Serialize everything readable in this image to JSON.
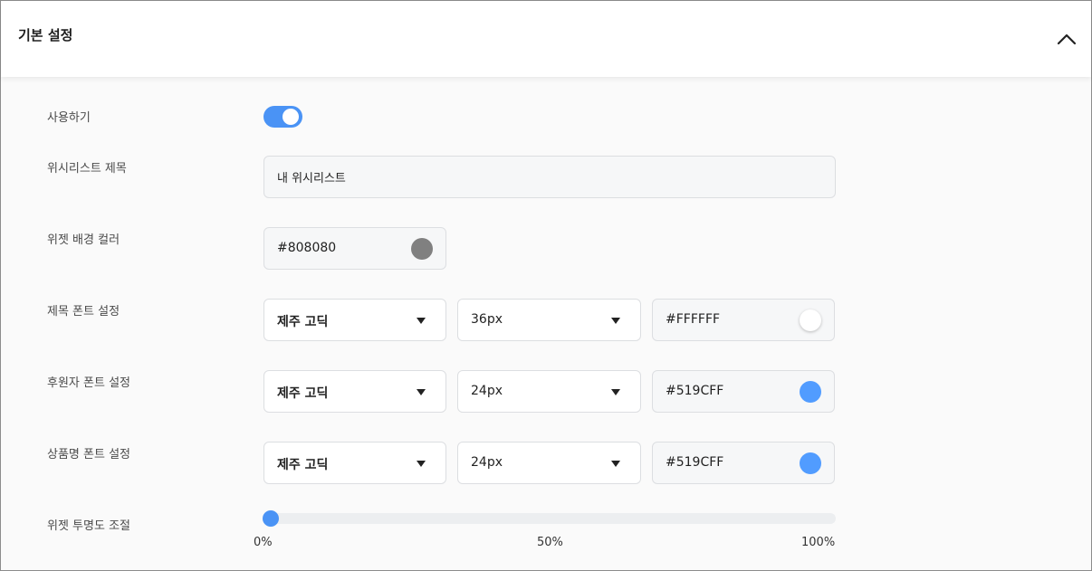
{
  "header": {
    "title": "기본 설정"
  },
  "settings": {
    "enable": {
      "label": "사용하기",
      "on": true
    },
    "wishlist_title": {
      "label": "위시리스트 제목",
      "value": "내 위시리스트"
    },
    "widget_bg_color": {
      "label": "위젯 배경 컬러",
      "value": "#808080",
      "swatch": "#808080"
    },
    "title_font": {
      "label": "제목 폰트 설정",
      "font": "제주 고딕",
      "size": "36px",
      "color": "#FFFFFF",
      "swatch": "#FFFFFF"
    },
    "sponsor_font": {
      "label": "후원자 폰트 설정",
      "font": "제주 고딕",
      "size": "24px",
      "color": "#519CFF",
      "swatch": "#519CFF"
    },
    "product_font": {
      "label": "상품명 폰트 설정",
      "font": "제주 고딕",
      "size": "24px",
      "color": "#519CFF",
      "swatch": "#519CFF"
    },
    "opacity": {
      "label": "위젯 투명도 조절",
      "value_percent": 0,
      "ticks": [
        "0%",
        "50%",
        "100%"
      ]
    }
  },
  "colors": {
    "accent": "#4A93F5"
  },
  "icons": {
    "collapse": "chevron-up-icon",
    "dropdown": "caret-down-icon"
  }
}
